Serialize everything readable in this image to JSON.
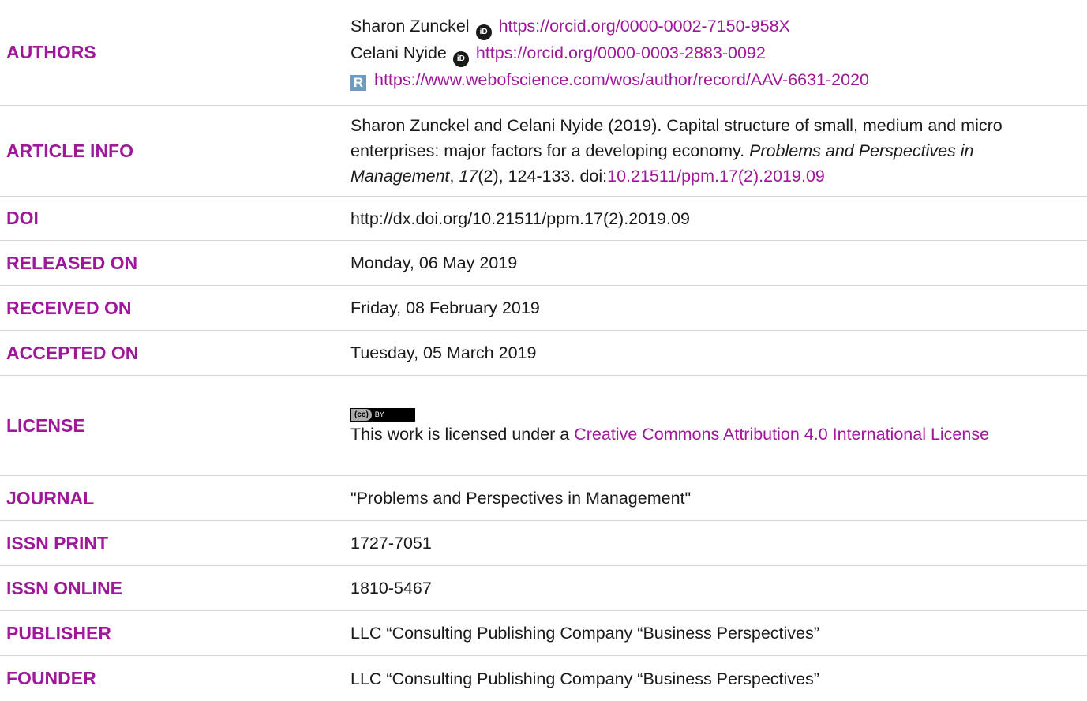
{
  "rows": {
    "authors": {
      "label": "AUTHORS",
      "author1_name": "Sharon Zunckel",
      "author1_orcid": "https://orcid.org/0000-0002-7150-958X",
      "author2_name": "Celani Nyide",
      "author2_orcid": "https://orcid.org/0000-0003-2883-0092",
      "author2_researcherid": "https://www.webofscience.com/wos/author/record/AAV-6631-2020",
      "orcid_icon_text": "iD",
      "researcherid_icon_text": "R"
    },
    "article_info": {
      "label": "ARTICLE INFO",
      "citation_prefix": "Sharon Zunckel and Celani Nyide (2019). Capital structure of small, medium and micro enterprises: major factors for a developing economy. ",
      "journal_italic": "Problems and Perspectives in Management",
      "sep1": ", ",
      "volume_italic": "17",
      "citation_suffix": "(2), 124-133. doi:",
      "doi_link": "10.21511/ppm.17(2).2019.09"
    },
    "doi": {
      "label": "DOI",
      "value": "http://dx.doi.org/10.21511/ppm.17(2).2019.09"
    },
    "released": {
      "label": "RELEASED ON",
      "value": "Monday, 06 May 2019"
    },
    "received": {
      "label": "RECEIVED ON",
      "value": "Friday, 08 February 2019"
    },
    "accepted": {
      "label": "ACCEPTED ON",
      "value": "Tuesday, 05 March 2019"
    },
    "license": {
      "label": "LICENSE",
      "badge_cc": "(cc)",
      "badge_by": "BY",
      "text": "This work is licensed under a ",
      "link": "Creative Commons Attribution 4.0 International License"
    },
    "journal": {
      "label": "JOURNAL",
      "value": "\"Problems and Perspectives in Management\""
    },
    "issn_print": {
      "label": "ISSN PRINT",
      "value": "1727-7051"
    },
    "issn_online": {
      "label": "ISSN ONLINE",
      "value": "1810-5467"
    },
    "publisher": {
      "label": "PUBLISHER",
      "value": "LLC “Consulting Publishing Company “Business Perspectives”"
    },
    "founder": {
      "label": "FOUNDER",
      "value": "LLC “Consulting Publishing Company “Business Perspectives”"
    }
  },
  "colors": {
    "accent": "#a0189a",
    "divider": "#d6d6d6",
    "text": "#1a1a1a"
  }
}
